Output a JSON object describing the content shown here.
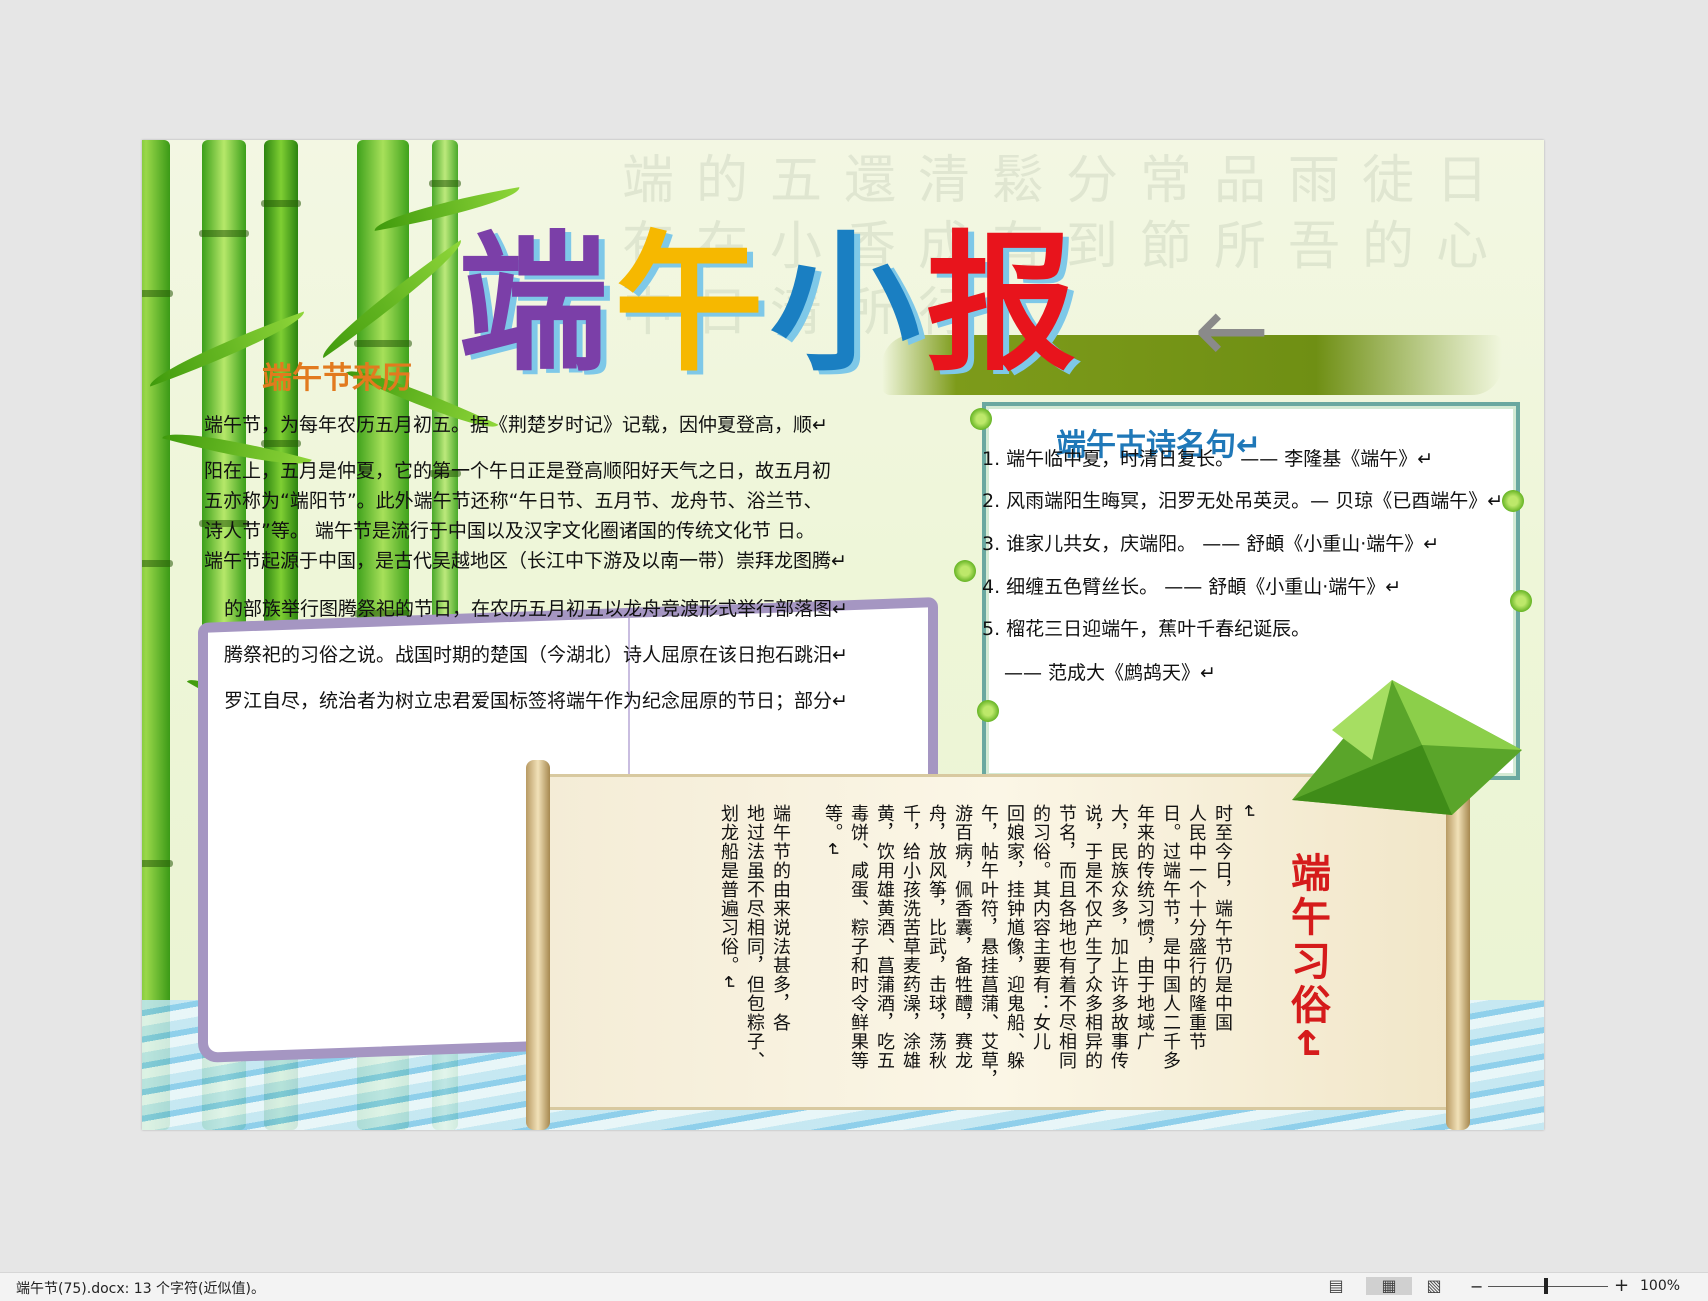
{
  "title": {
    "chars": [
      "端",
      "午",
      "小",
      "报"
    ],
    "colors": [
      "#7b3fa8",
      "#f6b800",
      "#1a7fc2",
      "#e8141c"
    ],
    "arrow": "←"
  },
  "background_text": "端的五還清鬆分常品雨徒日有在小香成有到節所吾的心中日清所行",
  "origin": {
    "heading": "端午节来历",
    "lines": [
      "端午节，为每年农历五月初五。据《荆楚岁时记》记载，因仲夏登高，顺↵",
      "阳在上，五月是仲夏，它的第一个午日正是登高顺阳好天气之日，故五月初",
      "五亦称为“端阳节”。此外端午节还称“午日节、五月节、龙舟节、浴兰节、",
      "诗人节”等。   端午节是流行于中国以及汉字文化圈诸国的传统文化节 日。",
      "端午节起源于中国，是古代吴越地区（长江中下游及以南一带）崇拜龙图腾↵"
    ],
    "book_lines": [
      "的部族举行图腾祭祀的节日，在农历五月初五以龙舟竞渡形式举行部落图↵",
      "腾祭祀的习俗之说。战国时期的楚国（今湖北）诗人屈原在该日抱石跳汨↵",
      "罗江自尽，统治者为树立忠君爱国标签将端午作为纪念屈原的节日；部分↵"
    ]
  },
  "poems": {
    "heading": "端午古诗名句↵",
    "items": [
      "1. 端午临中夏，时清日复长。 —— 李隆基《端午》↵",
      "2. 风雨端阳生晦冥，汨罗无处吊英灵。— 贝琼《已酉端午》↵",
      "3. 谁家儿共女，庆端阳。 —— 舒頔《小重山·端午》↵",
      "4. 细缠五色臂丝长。 —— 舒頔《小重山·端午》↵",
      "5. 榴花三日迎端午，蕉叶千春纪诞辰。",
      "—— 范成大《鹧鸪天》↵"
    ]
  },
  "customs": {
    "heading": "端午习俗↵",
    "columns": [
      "↵",
      "  时至今日，端午节仍是中国",
      "人民中一个十分盛行的隆重节",
      "日。过端午节，是中国人二千多",
      "年来的传统习惯，由于地域广",
      "大，民族众多，加上许多故事传",
      "说，于是不仅产生了众多相异的",
      "节名，而且各地也有着不尽相同",
      "的习俗。其内容主要有：女儿",
      "回娘家，挂钟馗像，迎鬼船、躲",
      "午，帖午叶符，悬挂菖蒲、艾草，",
      "游百病，佩香囊，备牲醴，赛龙",
      "舟，放风筝，比武，击球，荡秋",
      "千，给小孩洗苦草麦药澡，涂雄",
      "黄，饮用雄黄酒、菖蒲酒，吃五",
      "毒饼、咸蛋、粽子和时令鲜果等",
      "等。↵",
      "",
      "  端午节的由来说法甚多，各",
      "地过法虽不尽相同，但包粽子、",
      "划龙船是普遍习俗。↵"
    ]
  },
  "statusbar": {
    "doc_info": "端午节(75).docx: 13 个字符(近似值)。",
    "zoom_minus": "−",
    "zoom_plus": "+",
    "zoom_level": "100%"
  }
}
